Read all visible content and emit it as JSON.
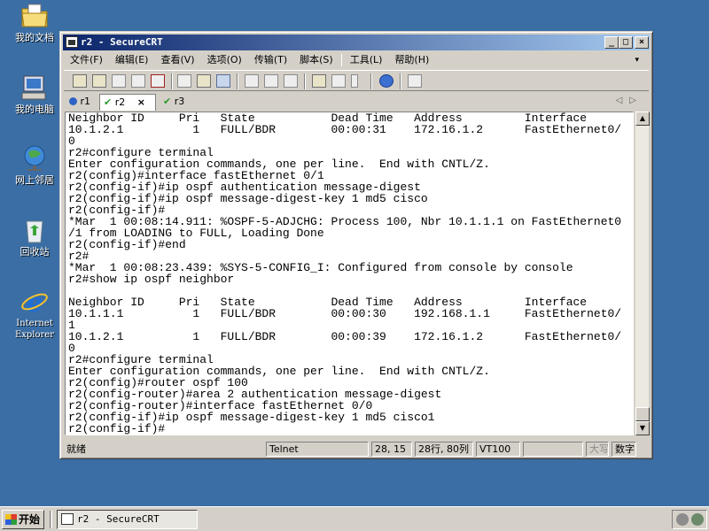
{
  "desktop": {
    "icons": [
      {
        "label": "我的文档",
        "icon": "my-documents-icon"
      },
      {
        "label": "我的电脑",
        "icon": "my-computer-icon"
      },
      {
        "label": "网上邻居",
        "icon": "network-places-icon"
      },
      {
        "label": "回收站",
        "icon": "recycle-bin-icon"
      },
      {
        "label": "Internet Explorer",
        "icon": "internet-explorer-icon"
      }
    ]
  },
  "window": {
    "title": "r2 - SecureCRT",
    "controls": {
      "minimize": "_",
      "maximize": "□",
      "close": "×"
    },
    "menu": [
      "文件(F)",
      "编辑(E)",
      "查看(V)",
      "选项(O)",
      "传输(T)",
      "脚本(S)",
      "工具(L)",
      "帮助(H)"
    ],
    "tabs": [
      {
        "label": "r1",
        "status": "info"
      },
      {
        "label": "r2",
        "status": "connected",
        "close": "×"
      },
      {
        "label": "r3",
        "status": "connected"
      }
    ],
    "terminal_lines": [
      "Neighbor ID     Pri   State           Dead Time   Address         Interface",
      "10.1.2.1          1   FULL/BDR        00:00:31    172.16.1.2      FastEthernet0/",
      "0",
      "r2#configure terminal",
      "Enter configuration commands, one per line.  End with CNTL/Z.",
      "r2(config)#interface fastEthernet 0/1",
      "r2(config-if)#ip ospf authentication message-digest",
      "r2(config-if)#ip ospf message-digest-key 1 md5 cisco",
      "r2(config-if)#",
      "*Mar  1 00:08:14.911: %OSPF-5-ADJCHG: Process 100, Nbr 10.1.1.1 on FastEthernet0",
      "/1 from LOADING to FULL, Loading Done",
      "r2(config-if)#end",
      "r2#",
      "*Mar  1 00:08:23.439: %SYS-5-CONFIG_I: Configured from console by console",
      "r2#show ip ospf neighbor",
      "",
      "Neighbor ID     Pri   State           Dead Time   Address         Interface",
      "10.1.1.1          1   FULL/BDR        00:00:30    192.168.1.1     FastEthernet0/",
      "1",
      "10.1.2.1          1   FULL/BDR        00:00:39    172.16.1.2      FastEthernet0/",
      "0",
      "r2#configure terminal",
      "Enter configuration commands, one per line.  End with CNTL/Z.",
      "r2(config)#router ospf 100",
      "r2(config-router)#area 2 authentication message-digest",
      "r2(config-router)#interface fastEthernet 0/0",
      "r2(config-if)#ip ospf message-digest-key 1 md5 cisco1",
      "r2(config-if)#"
    ],
    "status": {
      "ready": "就绪",
      "protocol": "Telnet",
      "cursor": "28, 15",
      "size": "28行, 80列",
      "emulation": "VT100",
      "caps": "大写",
      "num": "数字"
    }
  },
  "taskbar": {
    "start_label": "开始",
    "task_label": "r2 - SecureCRT"
  }
}
